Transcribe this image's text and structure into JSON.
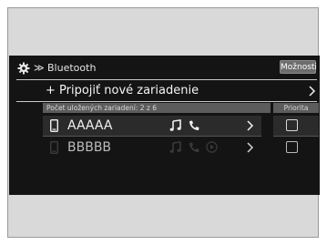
{
  "header": {
    "title": "≫ Bluetooth",
    "options_label": "Možnosti",
    "settings_icon": "gear-icon"
  },
  "add_device": {
    "label": "+ Pripojiť nové zariadenie"
  },
  "devices_section": {
    "count_label": "Počet uložených zariadení: 2 z 6",
    "priority_label": "Priorita"
  },
  "devices": [
    {
      "name": "AAAAA",
      "icons": [
        "phone-icon",
        "music-note-icon",
        "phone-call-icon",
        "chevron-right-icon"
      ],
      "priority_checked": false,
      "selected": true
    },
    {
      "name": "BBBBB",
      "icons": [
        "phone-icon",
        "music-note-icon",
        "phone-call-icon",
        "play-circle-icon",
        "chevron-right-icon"
      ],
      "priority_checked": false,
      "selected": false
    }
  ],
  "colors": {
    "screen_bg": "#141414",
    "frame_bg": "#d9d9d9",
    "section_bar": "#5c5c5c",
    "button_bg": "#6d6d6d"
  }
}
